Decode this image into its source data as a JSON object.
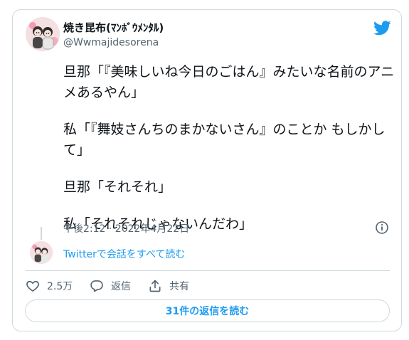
{
  "user": {
    "display_name": "焼き昆布(ﾏﾝﾎﾞｳﾒﾝﾀﾙ)",
    "handle": "@Wwmajidesorena",
    "avatar_icon": "user-avatar"
  },
  "brand": {
    "icon": "twitter-bird-icon",
    "color": "#1d9bf0"
  },
  "tweet": {
    "paragraphs": [
      "旦那「『美味しいね今日のごはん』みたいな名前のアニメあるやん」",
      "私「『舞妓さんちのまかないさん』のことか もしかして」",
      "旦那「それそれ」",
      "私「それそれじゃないんだわ」"
    ],
    "timestamp": "午後2:12 · 2022年4月22日",
    "info_icon": "info-icon"
  },
  "thread": {
    "view_conversation_label": "Twitterで会話をすべて読む"
  },
  "actions": {
    "like": {
      "icon": "heart-icon",
      "count": "2.5万"
    },
    "reply": {
      "icon": "reply-icon",
      "label": "返信"
    },
    "share": {
      "icon": "share-icon",
      "label": "共有"
    }
  },
  "replies_button": {
    "label": "31件の返信を読む"
  },
  "colors": {
    "text": "#0f1419",
    "secondary": "#536471",
    "accent": "#1d9bf0",
    "border": "#cfd9de"
  }
}
